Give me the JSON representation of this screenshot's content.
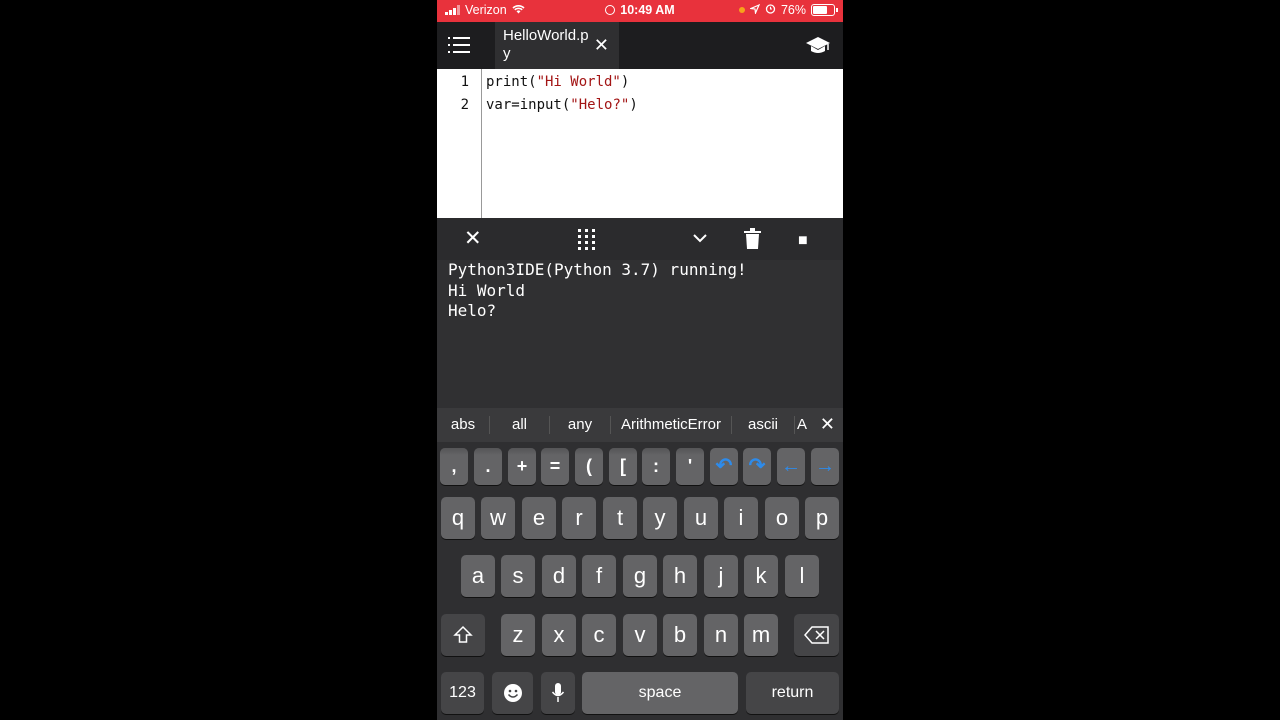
{
  "status_bar": {
    "carrier": "Verizon",
    "time": "10:49 AM",
    "battery": "76%",
    "background": "#e8323c"
  },
  "toolbar": {
    "menu_icon": "hamburger-menu-icon",
    "tab_label": "HelloWorld.py",
    "tab_close": "✕",
    "right_icon": "graduation-cap-icon"
  },
  "editor": {
    "line_numbers": [
      "1",
      "2"
    ],
    "lines": [
      {
        "pre": "print(",
        "str": "\"Hi World\"",
        "post": ")"
      },
      {
        "pre": "var=input(",
        "str": "\"Helo?\"",
        "post": ")"
      }
    ]
  },
  "console_toolbar": {
    "close": "✕",
    "grid": "⋮⋮⋮",
    "collapse": "⌄",
    "trash": "trash-icon",
    "stop": "■"
  },
  "console": {
    "lines": [
      "Python3IDE(Python 3.7) running!",
      "Hi World",
      "Helo?"
    ]
  },
  "suggestions": {
    "items": [
      "abs",
      "all",
      "any",
      "ArithmeticError",
      "ascii",
      "A"
    ],
    "close": "✕"
  },
  "symbol_row": [
    ",",
    ".",
    "+",
    "=",
    "(",
    "[",
    ":",
    "'",
    "↶",
    "↷",
    "←",
    "→"
  ],
  "keyboard": {
    "row1": [
      "q",
      "w",
      "e",
      "r",
      "t",
      "y",
      "u",
      "i",
      "o",
      "p"
    ],
    "row2": [
      "a",
      "s",
      "d",
      "f",
      "g",
      "h",
      "j",
      "k",
      "l"
    ],
    "row3": [
      "z",
      "x",
      "c",
      "v",
      "b",
      "n",
      "m"
    ],
    "numbers": "123",
    "space": "space",
    "return": "return"
  }
}
